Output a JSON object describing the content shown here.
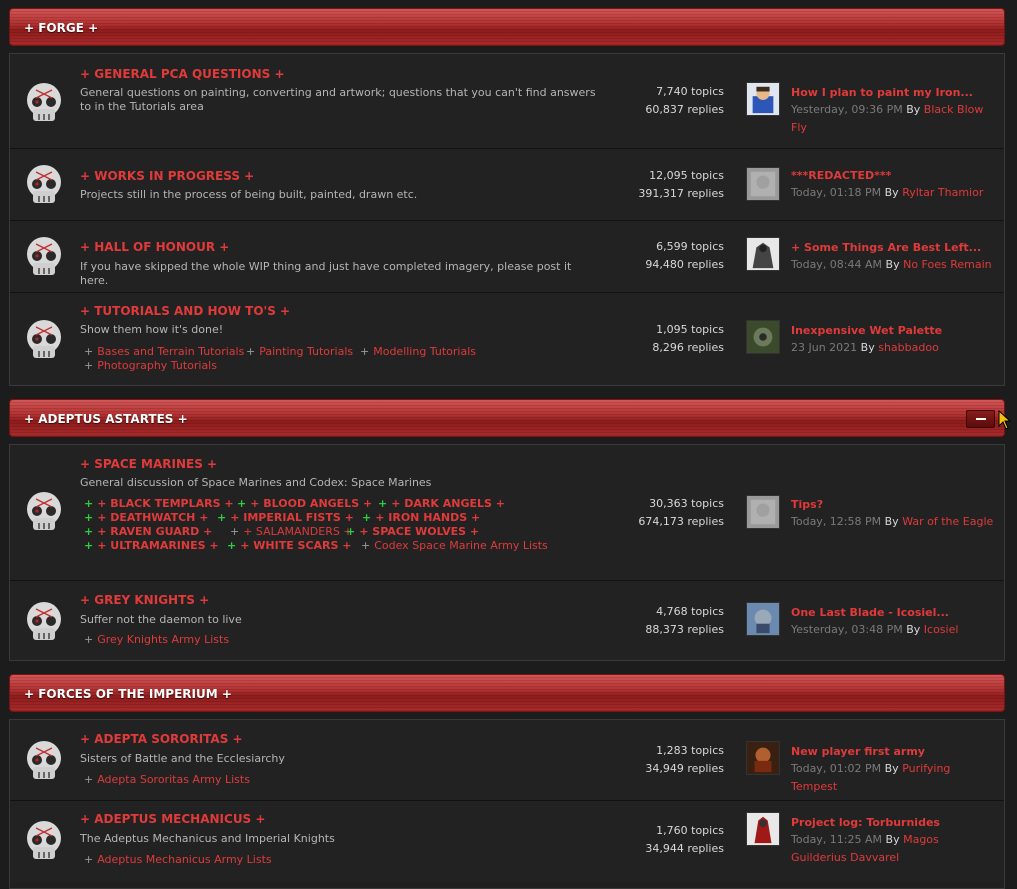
{
  "categories": [
    {
      "title": "+ FORGE +",
      "forums": [
        {
          "title": "+ GENERAL PCA QUESTIONS +",
          "desc": "General questions on painting, converting and artwork; questions that you can't find answers to in the Tutorials area",
          "topics": "7,740 topics",
          "replies": "60,837 replies",
          "last_title": "How I plan to paint my Iron...",
          "last_time": "Yesterday, 09:36 PM",
          "last_by": "By",
          "last_user": "Black Blow Fly",
          "avatar_color": "#2c56b8"
        },
        {
          "title": "+ WORKS IN PROGRESS +",
          "desc": "Projects still in the process of being built, painted, drawn etc.",
          "topics": "12,095 topics",
          "replies": "391,317 replies",
          "last_title": "***REDACTED***",
          "last_time": "Today, 01:18 PM",
          "last_by": "By",
          "last_user": "Ryltar Thamior",
          "avatar_color": "#9a9a9a"
        },
        {
          "title": "+ HALL OF HONOUR +",
          "desc": "If you have skipped the whole WIP thing and just have completed imagery, please post it here.",
          "topics": "6,599 topics",
          "replies": "94,480 replies",
          "last_title": "+ Some Things Are Best Left...",
          "last_time": "Today, 08:44 AM",
          "last_by": "By",
          "last_user": "No Foes Remain",
          "avatar_color": "#555555"
        },
        {
          "title": "+ TUTORIALS AND HOW TO'S +",
          "desc": "Show them how it's done!",
          "subs": [
            "Bases and Terrain Tutorials",
            "Painting Tutorials",
            "Modelling Tutorials",
            "Photography Tutorials"
          ],
          "topics": "1,095 topics",
          "replies": "8,296 replies",
          "last_title": "Inexpensive Wet Palette",
          "last_time": "23 Jun 2021",
          "last_by": "By",
          "last_user": "shabbadoo",
          "avatar_color": "#4a5a3a"
        }
      ]
    },
    {
      "title": "+ ADEPTUS ASTARTES +",
      "forums": [
        {
          "title": "+ SPACE MARINES +",
          "desc": "General discussion of Space Marines and Codex: Space Marines",
          "subs": [
            "+ BLACK TEMPLARS +",
            "+ BLOOD ANGELS +",
            "+ DARK ANGELS +",
            "+ DEATHWATCH +",
            "+ IMPERIAL FISTS +",
            "+ IRON HANDS +",
            "+ RAVEN GUARD +",
            "+ SALAMANDERS +",
            "+ SPACE WOLVES +",
            "+ ULTRAMARINES +",
            "+ WHITE SCARS +",
            "Codex Space Marine Army Lists"
          ],
          "topics": "30,363 topics",
          "replies": "674,173 replies",
          "last_title": "Tips?",
          "last_time": "Today, 12:58 PM",
          "last_by": "By",
          "last_user": "War of the Eagle",
          "avatar_color": "#9a9a9a"
        },
        {
          "title": "+ GREY KNIGHTS +",
          "desc": "Suffer not the daemon to live",
          "subs": [
            "Grey Knights Army Lists"
          ],
          "topics": "4,768 topics",
          "replies": "88,373 replies",
          "last_title": "One Last Blade - Icosiel...",
          "last_time": "Yesterday, 03:48 PM",
          "last_by": "By",
          "last_user": "Icosiel",
          "avatar_color": "#3a6a9a"
        }
      ]
    },
    {
      "title": "+ FORCES OF THE IMPERIUM +",
      "forums": [
        {
          "title": "+ ADEPTA SORORITAS +",
          "desc": "Sisters of Battle and the Ecclesiarchy",
          "subs": [
            "Adepta Sororitas Army Lists"
          ],
          "topics": "1,283 topics",
          "replies": "34,949 replies",
          "last_title": "New player first army",
          "last_time": "Today, 01:02 PM",
          "last_by": "By",
          "last_user": "Purifying Tempest",
          "avatar_color": "#7a3a1a"
        },
        {
          "title": "+ ADEPTUS MECHANICUS +",
          "desc": "The Adeptus Mechanicus and Imperial Knights",
          "subs": [
            "Adeptus Mechanicus Army Lists"
          ],
          "topics": "1,760 topics",
          "replies": "34,944 replies",
          "last_title": "Project log: Torburnides",
          "last_time": "Today, 11:25 AM",
          "last_by": "By",
          "last_user": "Magos Guilderius Davvarel",
          "avatar_color": "#8a1a1a"
        }
      ]
    }
  ],
  "colors": {
    "accent": "#e03a3a",
    "header": "#b33232",
    "unread_marker": "#2ecc40"
  },
  "icons": {
    "forum_icon": "skull-icon",
    "collapse": "minus-icon",
    "cursor": "pointer-cursor-icon"
  }
}
